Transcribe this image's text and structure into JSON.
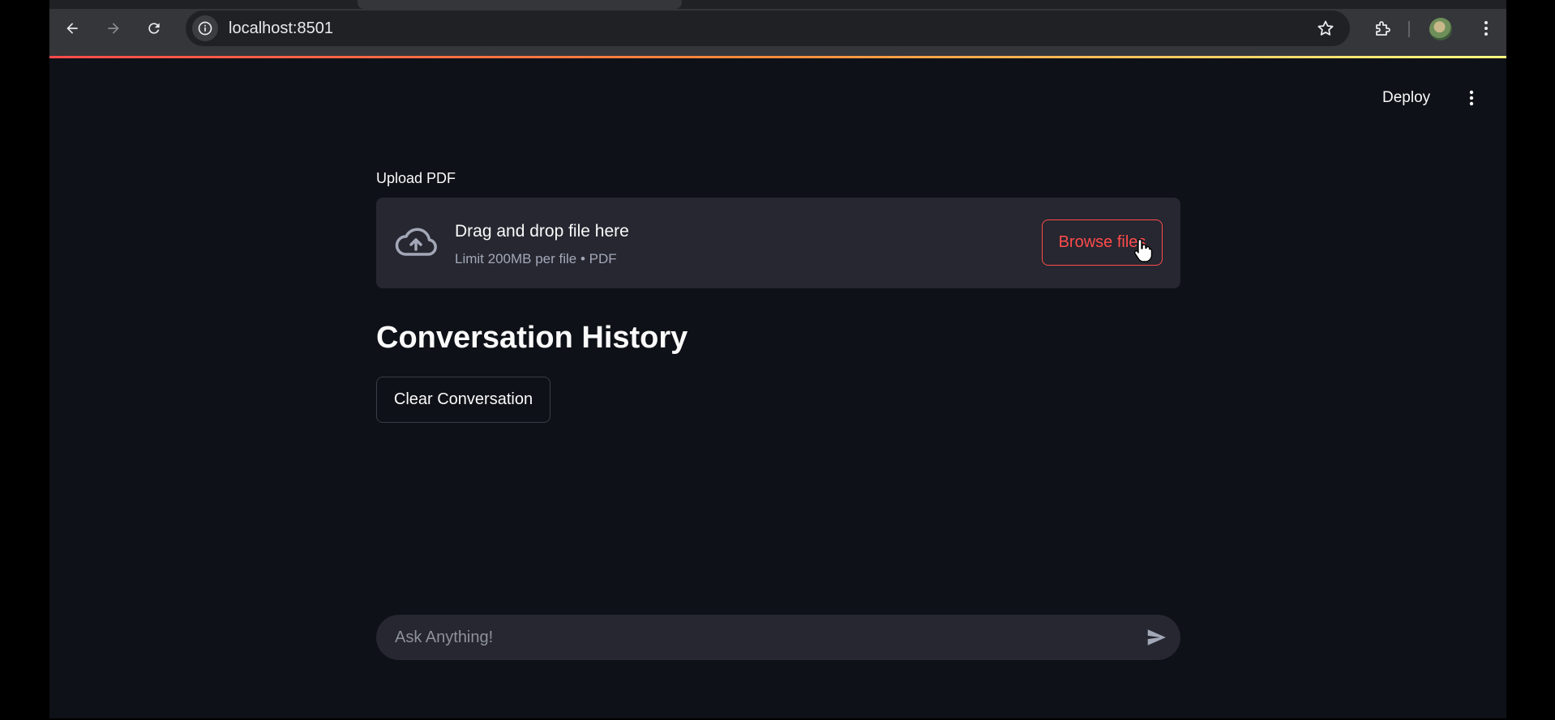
{
  "browser": {
    "url": "localhost:8501"
  },
  "header": {
    "deploy_label": "Deploy"
  },
  "uploader": {
    "label": "Upload PDF",
    "title": "Drag and drop file here",
    "subtitle": "Limit 200MB per file • PDF",
    "browse_label": "Browse files"
  },
  "conversation": {
    "title": "Conversation History",
    "clear_label": "Clear Conversation"
  },
  "chat": {
    "placeholder": "Ask Anything!"
  },
  "icons": {
    "back": "arrow-left-icon",
    "forward": "arrow-right-icon",
    "reload": "reload-icon",
    "site_info": "info-icon",
    "bookmark": "star-icon",
    "extensions": "puzzle-icon",
    "menu": "kebab-icon",
    "upload": "cloud-upload-icon",
    "send": "send-icon"
  },
  "colors": {
    "background": "#0e1117",
    "surface": "#262730",
    "accent": "#ff4b4b",
    "text": "#fafafa"
  }
}
